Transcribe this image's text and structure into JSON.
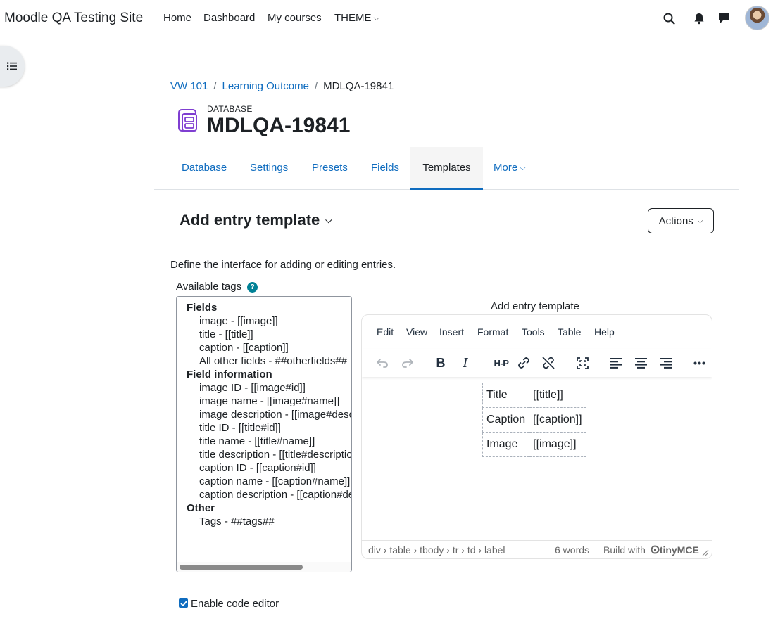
{
  "navbar": {
    "site_name": "Moodle QA Testing Site",
    "links": [
      "Home",
      "Dashboard",
      "My courses",
      "THEME"
    ],
    "icons": [
      "search-icon",
      "bell-icon",
      "chat-icon"
    ]
  },
  "breadcrumb": {
    "items": [
      "VW 101",
      "Learning Outcome",
      "MDLQA-19841"
    ],
    "separator": "/"
  },
  "activity": {
    "type_label": "DATABASE",
    "title": "MDLQA-19841",
    "icon": "database-icon",
    "icon_color": "#7f3ed1"
  },
  "tabs": {
    "items": [
      "Database",
      "Settings",
      "Presets",
      "Fields",
      "Templates",
      "More"
    ],
    "active": "Templates"
  },
  "template": {
    "heading": "Add entry template",
    "actions_label": "Actions",
    "description": "Define the interface for adding or editing entries."
  },
  "available_tags": {
    "label": "Available tags",
    "groups": [
      {
        "title": "Fields",
        "items": [
          "image - [[image]]",
          "title - [[title]]",
          "caption - [[caption]]",
          "All other fields - ##otherfields##"
        ]
      },
      {
        "title": "Field information",
        "items": [
          "image ID - [[image#id]]",
          "image name - [[image#name]]",
          "image description - [[image#description]]",
          "title ID - [[title#id]]",
          "title name - [[title#name]]",
          "title description - [[title#description]]",
          "caption ID - [[caption#id]]",
          "caption name - [[caption#name]]",
          "caption description - [[caption#description]]"
        ]
      },
      {
        "title": "Other",
        "items": [
          "Tags - ##tags##"
        ]
      }
    ]
  },
  "editor": {
    "label": "Add entry template",
    "menu": [
      "Edit",
      "View",
      "Insert",
      "Format",
      "Tools",
      "Table",
      "Help"
    ],
    "toolbar": [
      "undo-icon",
      "redo-icon",
      "bold-icon",
      "italic-icon",
      "h5p-icon",
      "link-icon",
      "unlink-icon",
      "fullscreen-icon",
      "align-left-icon",
      "align-center-icon",
      "align-right-icon",
      "more-icon"
    ],
    "bold_glyph": "B",
    "italic_glyph": "I",
    "h5p_glyph": "H-P",
    "table": [
      [
        "Title",
        "[[title]]"
      ],
      [
        "Caption",
        "[[caption]]"
      ],
      [
        "Image",
        "[[image]]"
      ]
    ],
    "status_path": "div › table › tbody › tr › td › label",
    "word_count": "6 words",
    "build_with": "Build with",
    "brand": "tinyMCE"
  },
  "code_editor": {
    "label": "Enable code editor",
    "checked": true
  },
  "colors": {
    "link": "#0f6cbf",
    "text": "#1d2125",
    "help": "#008196"
  }
}
